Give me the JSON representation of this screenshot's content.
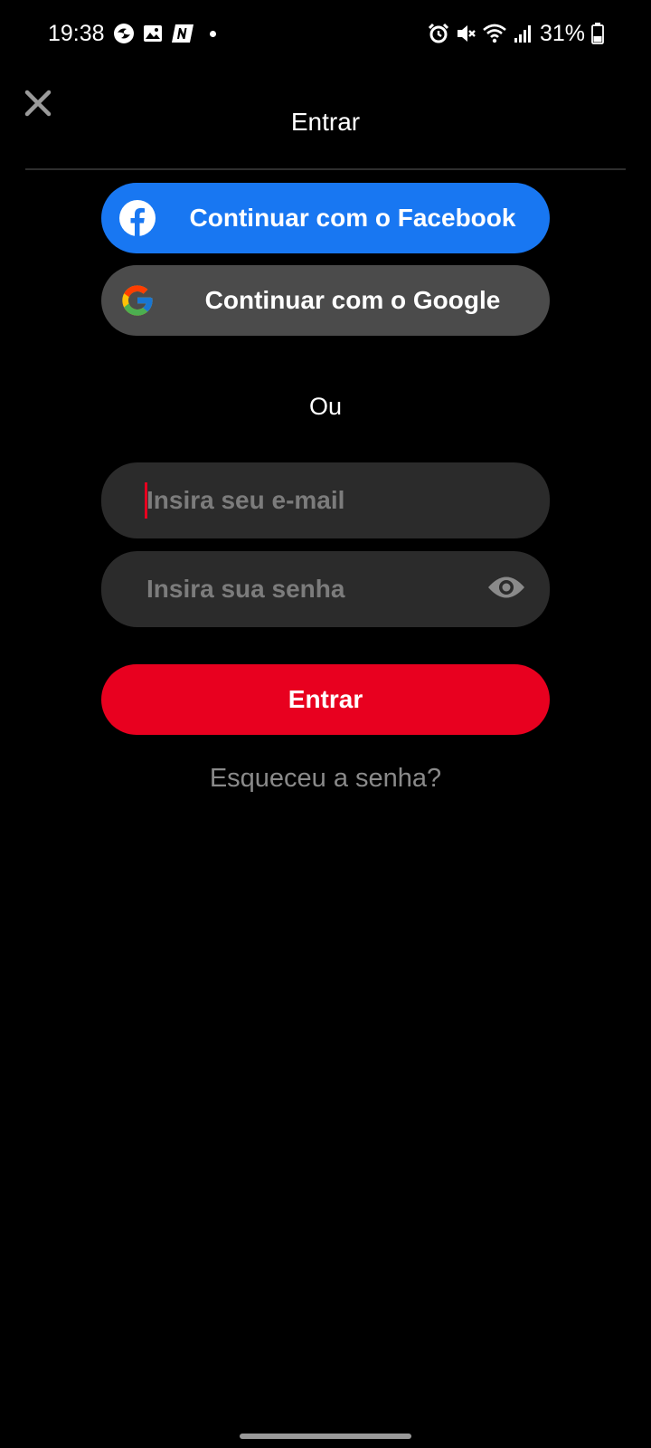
{
  "status_bar": {
    "time": "19:38",
    "left_icons": [
      "pinwheel-icon",
      "gallery-icon",
      "news-app-icon",
      "notification-dot"
    ],
    "right_icons": [
      "alarm-icon",
      "vibrate-mute-icon",
      "wifi-icon",
      "signal-icon",
      "battery-icon"
    ],
    "battery": "31%"
  },
  "header": {
    "title": "Entrar",
    "close_icon": "close-icon"
  },
  "social": {
    "facebook_label": "Continuar com o Facebook",
    "google_label": "Continuar com o Google"
  },
  "divider_text": "Ou",
  "form": {
    "email_placeholder": "Insira seu e-mail",
    "email_value": "",
    "password_placeholder": "Insira sua senha",
    "password_value": "",
    "submit_label": "Entrar",
    "forgot_label": "Esqueceu a senha?"
  },
  "colors": {
    "background": "#000000",
    "facebook_blue": "#1877f2",
    "google_gray": "#4b4b4b",
    "input_bg": "#2b2b2b",
    "primary_red": "#e8001f",
    "muted_text": "#8a8a8a"
  }
}
